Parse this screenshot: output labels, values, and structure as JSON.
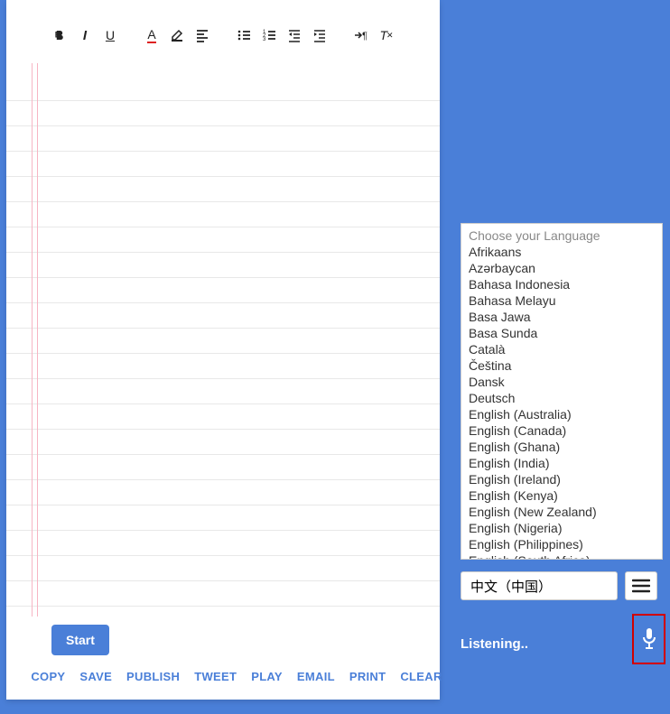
{
  "toolbar": {
    "buttons": [
      "bold",
      "italic",
      "underline",
      "font-color",
      "highlight",
      "align",
      "unordered-list",
      "ordered-list",
      "outdent",
      "indent",
      "paragraph-dir",
      "clear-format"
    ]
  },
  "start_label": "Start",
  "actions": [
    {
      "id": "copy",
      "label": "COPY"
    },
    {
      "id": "save",
      "label": "SAVE"
    },
    {
      "id": "publish",
      "label": "PUBLISH"
    },
    {
      "id": "tweet",
      "label": "TWEET"
    },
    {
      "id": "play",
      "label": "PLAY"
    },
    {
      "id": "email",
      "label": "EMAIL"
    },
    {
      "id": "print",
      "label": "PRINT"
    },
    {
      "id": "clear",
      "label": "CLEAR"
    }
  ],
  "language_header": "Choose your Language",
  "languages": [
    "Afrikaans",
    "Azərbaycan",
    "Bahasa Indonesia",
    "Bahasa Melayu",
    "Basa Jawa",
    "Basa Sunda",
    "Català",
    "Čeština",
    "Dansk",
    "Deutsch",
    "English (Australia)",
    "English (Canada)",
    "English (Ghana)",
    "English (India)",
    "English (Ireland)",
    "English (Kenya)",
    "English (New Zealand)",
    "English (Nigeria)",
    "English (Philippines)",
    "English (South Africa)"
  ],
  "selected_language": "中文（中国）",
  "status": "Listening.."
}
